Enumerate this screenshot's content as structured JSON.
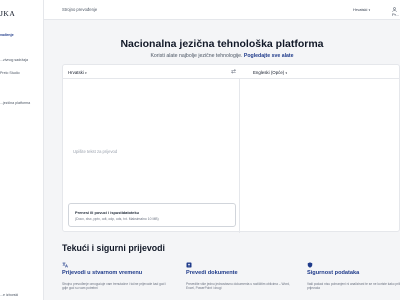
{
  "sidebar": {
    "logo": "JKA",
    "items": [
      {
        "label": "vođenje"
      },
      {
        "label": "...zivnog sadržaja"
      },
      {
        "label": "Prelo Studio"
      },
      {
        "label": "...jezična platforma"
      }
    ],
    "footer": "...e izborski"
  },
  "header": {
    "title": "Strojno prevođenje",
    "language": "Hrvatski",
    "user": "Pr..."
  },
  "hero": {
    "title": "Nacionalna jezična tehnološka platforma",
    "subtitle": "Koristi alate najbolje jezične tehnologije.",
    "link": "Pogledajte sve alate"
  },
  "translator": {
    "source_lang": "Hrvatski",
    "target_lang": "Engleski (Opće)",
    "placeholder": "Upišite tekst za prijevod",
    "upload_title": "Prenesi ili povuci i ispustidatoteku",
    "upload_desc": "(Docx, xlsx, pptx, odt, odp, ods, txt. Maksimalno 10 MB)"
  },
  "features": {
    "title": "Tekući i sigurni prijevodi",
    "items": [
      {
        "icon": "translate-icon",
        "title": "Prijevodi u stvarnom vremenu",
        "desc": "Strojno prevođenje omogućuje vam trenutačne i točne prijevode kad god i gdje god su vam potrebni"
      },
      {
        "icon": "upload-icon",
        "title": "Prevedi dokumente",
        "desc": "Prevedite više jednu jednostavnu dokumenta u različitim oblicima – Word, Excel, PowerPoint i drugi"
      },
      {
        "icon": "shield-icon",
        "title": "Sigurnost podataka",
        "desc": "Vaši podaci nisu pohranjeni ni analizirani te se ne koriste kako prilikom prijevoda"
      }
    ]
  },
  "colors": {
    "accent": "#1e3a8a",
    "text": "#111827",
    "muted": "#6b7280",
    "background": "#f4f5f7"
  }
}
